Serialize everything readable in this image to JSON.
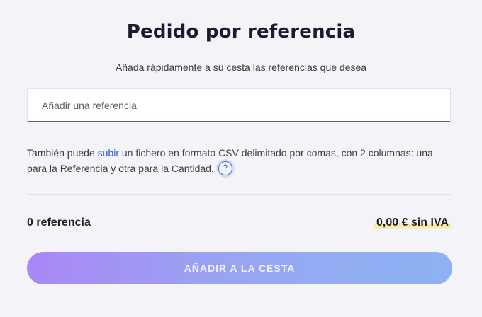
{
  "header": {
    "title": "Pedido por referencia",
    "subtitle": "Añada rápidamente a su cesta las referencias que desea"
  },
  "reference_input": {
    "placeholder": "Añadir una referencia",
    "value": ""
  },
  "info": {
    "text_before_link": "También puede ",
    "link_label": "subir",
    "text_after_link": " un fichero en formato CSV delimitado por comas, con 2 columnas: una para la Referencia y otra para la Cantidad.",
    "help_glyph": "?"
  },
  "summary": {
    "count_label": "0 referencia",
    "price_label": "0,00 € sin IVA"
  },
  "actions": {
    "add_to_cart_label": "AÑADIR A LA CESTA"
  },
  "colors": {
    "link": "#2c62d6",
    "button_gradient_start": "#a987f4",
    "button_gradient_end": "#8cb2f3",
    "price_highlight": "#fbeaa6"
  },
  "icons": {
    "help": "question-circle-icon"
  }
}
